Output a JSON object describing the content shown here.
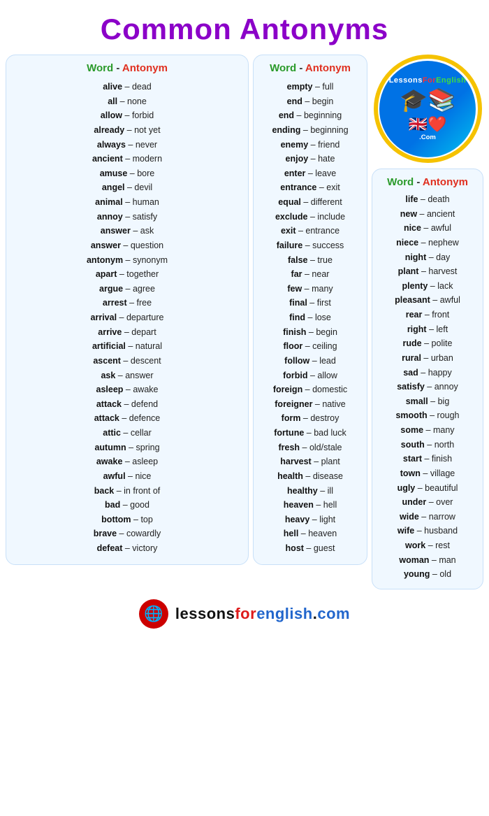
{
  "title": "Common Antonyms",
  "header": {
    "word_label": "Word",
    "dash": " - ",
    "antonym_label": "Antonym"
  },
  "col1": [
    {
      "word": "alive",
      "antonym": "dead"
    },
    {
      "word": "all",
      "antonym": "none"
    },
    {
      "word": "allow",
      "antonym": "forbid"
    },
    {
      "word": "already",
      "antonym": "not yet"
    },
    {
      "word": "always",
      "antonym": "never"
    },
    {
      "word": "ancient",
      "antonym": "modern"
    },
    {
      "word": "amuse",
      "antonym": "bore"
    },
    {
      "word": "angel",
      "antonym": "devil"
    },
    {
      "word": "animal",
      "antonym": "human"
    },
    {
      "word": "annoy",
      "antonym": "satisfy"
    },
    {
      "word": "answer",
      "antonym": "ask"
    },
    {
      "word": "answer",
      "antonym": "question"
    },
    {
      "word": "antonym",
      "antonym": "synonym"
    },
    {
      "word": "apart",
      "antonym": "together"
    },
    {
      "word": "argue",
      "antonym": "agree"
    },
    {
      "word": "arrest",
      "antonym": "free"
    },
    {
      "word": "arrival",
      "antonym": "departure"
    },
    {
      "word": "arrive",
      "antonym": "depart"
    },
    {
      "word": "artificial",
      "antonym": "natural"
    },
    {
      "word": "ascent",
      "antonym": "descent"
    },
    {
      "word": "ask",
      "antonym": "answer"
    },
    {
      "word": "asleep",
      "antonym": "awake"
    },
    {
      "word": "attack",
      "antonym": "defend"
    },
    {
      "word": "attack",
      "antonym": "defence"
    },
    {
      "word": "attic",
      "antonym": "cellar"
    },
    {
      "word": "autumn",
      "antonym": "spring"
    },
    {
      "word": "awake",
      "antonym": "asleep"
    },
    {
      "word": "awful",
      "antonym": "nice"
    },
    {
      "word": "back",
      "antonym": "in front of"
    },
    {
      "word": "bad",
      "antonym": "good"
    },
    {
      "word": "bottom",
      "antonym": "top"
    },
    {
      "word": "brave",
      "antonym": "cowardly"
    },
    {
      "word": "defeat",
      "antonym": "victory"
    }
  ],
  "col2": [
    {
      "word": "empty",
      "antonym": "full"
    },
    {
      "word": "end",
      "antonym": "begin"
    },
    {
      "word": "end",
      "antonym": "beginning"
    },
    {
      "word": "ending",
      "antonym": "beginning"
    },
    {
      "word": "enemy",
      "antonym": "friend"
    },
    {
      "word": "enjoy",
      "antonym": "hate"
    },
    {
      "word": "enter",
      "antonym": "leave"
    },
    {
      "word": "entrance",
      "antonym": "exit"
    },
    {
      "word": "equal",
      "antonym": "different"
    },
    {
      "word": "exclude",
      "antonym": "include"
    },
    {
      "word": "exit",
      "antonym": "entrance"
    },
    {
      "word": "failure",
      "antonym": "success"
    },
    {
      "word": "false",
      "antonym": "true"
    },
    {
      "word": "far",
      "antonym": "near"
    },
    {
      "word": "few",
      "antonym": "many"
    },
    {
      "word": "final",
      "antonym": "first"
    },
    {
      "word": "find",
      "antonym": "lose"
    },
    {
      "word": "finish",
      "antonym": "begin"
    },
    {
      "word": "floor",
      "antonym": "ceiling"
    },
    {
      "word": "follow",
      "antonym": "lead"
    },
    {
      "word": "forbid",
      "antonym": "allow"
    },
    {
      "word": "foreign",
      "antonym": "domestic"
    },
    {
      "word": "foreigner",
      "antonym": "native"
    },
    {
      "word": "form",
      "antonym": "destroy"
    },
    {
      "word": "fortune",
      "antonym": "bad luck"
    },
    {
      "word": "fresh",
      "antonym": "old/stale"
    },
    {
      "word": "harvest",
      "antonym": "plant"
    },
    {
      "word": "health",
      "antonym": "disease"
    },
    {
      "word": "healthy",
      "antonym": "ill"
    },
    {
      "word": "heaven",
      "antonym": "hell"
    },
    {
      "word": "heavy",
      "antonym": "light"
    },
    {
      "word": "hell",
      "antonym": "heaven"
    },
    {
      "word": "host",
      "antonym": "guest"
    }
  ],
  "col3": [
    {
      "word": "life",
      "antonym": "death"
    },
    {
      "word": "new",
      "antonym": "ancient"
    },
    {
      "word": "nice",
      "antonym": "awful"
    },
    {
      "word": "niece",
      "antonym": "nephew"
    },
    {
      "word": "night",
      "antonym": "day"
    },
    {
      "word": "plant",
      "antonym": "harvest"
    },
    {
      "word": "plenty",
      "antonym": "lack"
    },
    {
      "word": "pleasant",
      "antonym": "awful"
    },
    {
      "word": "rear",
      "antonym": "front"
    },
    {
      "word": "right",
      "antonym": "left"
    },
    {
      "word": "rude",
      "antonym": "polite"
    },
    {
      "word": "rural",
      "antonym": "urban"
    },
    {
      "word": "sad",
      "antonym": "happy"
    },
    {
      "word": "satisfy",
      "antonym": "annoy"
    },
    {
      "word": "small",
      "antonym": "big"
    },
    {
      "word": "smooth",
      "antonym": "rough"
    },
    {
      "word": "some",
      "antonym": "many"
    },
    {
      "word": "south",
      "antonym": "north"
    },
    {
      "word": "start",
      "antonym": "finish"
    },
    {
      "word": "town",
      "antonym": "village"
    },
    {
      "word": "ugly",
      "antonym": "beautiful"
    },
    {
      "word": "under",
      "antonym": "over"
    },
    {
      "word": "wide",
      "antonym": "narrow"
    },
    {
      "word": "wife",
      "antonym": "husband"
    },
    {
      "word": "work",
      "antonym": "rest"
    },
    {
      "word": "woman",
      "antonym": "man"
    },
    {
      "word": "young",
      "antonym": "old"
    }
  ],
  "footer": {
    "url": "lessonsforenglish.com"
  }
}
